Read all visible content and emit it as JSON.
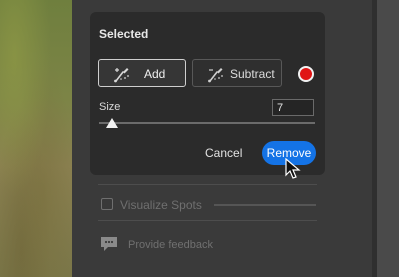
{
  "section_title": "Selected",
  "buttons": {
    "add_label": "Add",
    "subtract_label": "Subtract",
    "cancel_label": "Cancel",
    "remove_label": "Remove"
  },
  "overlay_color": "#e01414",
  "size": {
    "label": "Size",
    "value": "7"
  },
  "visualize_spots": {
    "label": "Visualize Spots",
    "checked": false
  },
  "feedback": {
    "label": "Provide feedback"
  },
  "icons": [
    "brush-add-icon",
    "brush-subtract-icon",
    "feedback-icon",
    "mouse-cursor-icon"
  ]
}
